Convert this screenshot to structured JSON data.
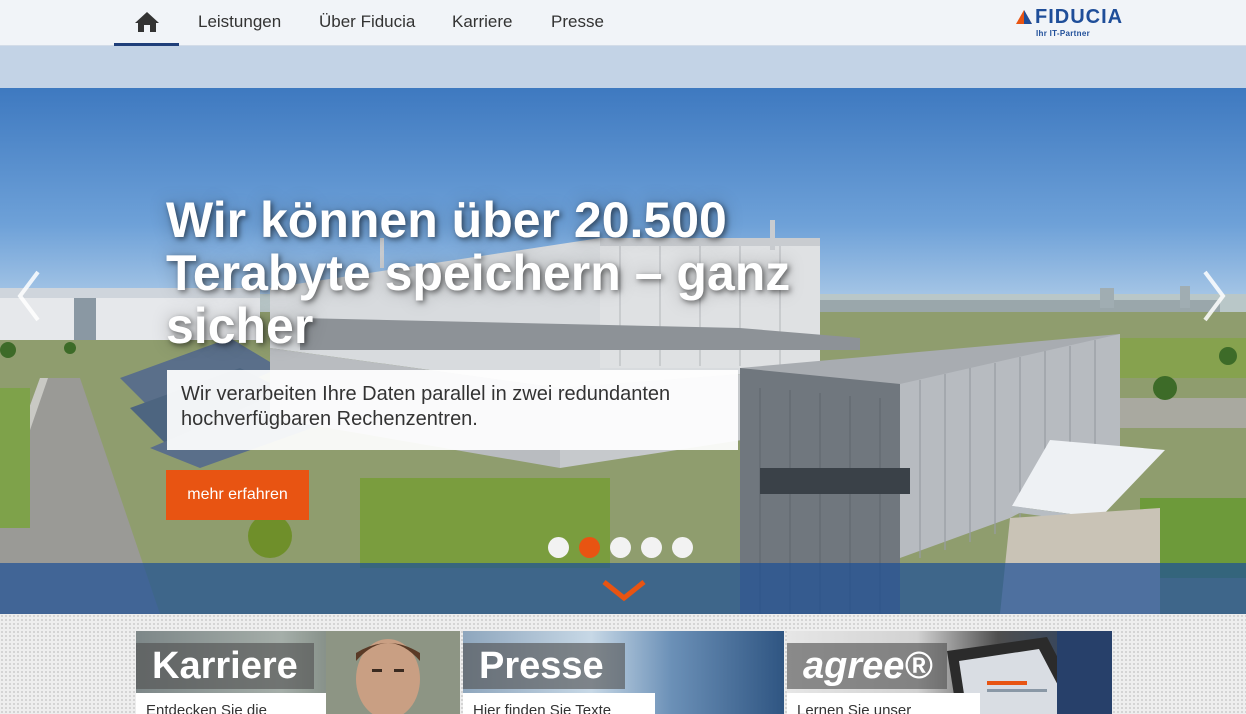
{
  "nav": {
    "home_icon": "home-icon",
    "items": [
      {
        "label": "Leistungen"
      },
      {
        "label": "Über Fiducia"
      },
      {
        "label": "Karriere"
      },
      {
        "label": "Presse"
      }
    ],
    "logo": {
      "name": "FIDUCIA",
      "tagline": "Ihr IT-Partner"
    }
  },
  "hero": {
    "headline": "Wir können über 20.500 Terabyte speichern – ganz sicher",
    "subtext": "Wir verarbeiten Ihre Daten parallel in zwei redundanten hochverfügbaren Rechenzentren.",
    "cta_label": "mehr erfahren",
    "slide_count": 5,
    "active_slide": 2
  },
  "teasers": [
    {
      "title": "Karriere",
      "text": "Entdecken Sie die"
    },
    {
      "title": "Presse",
      "text": "Hier finden Sie Texte"
    },
    {
      "title": "agree®",
      "text": "Lernen Sie unser"
    }
  ],
  "colors": {
    "accent": "#e85412",
    "brand_blue": "#1f4e99",
    "nav_background": "#f1f4f8"
  }
}
